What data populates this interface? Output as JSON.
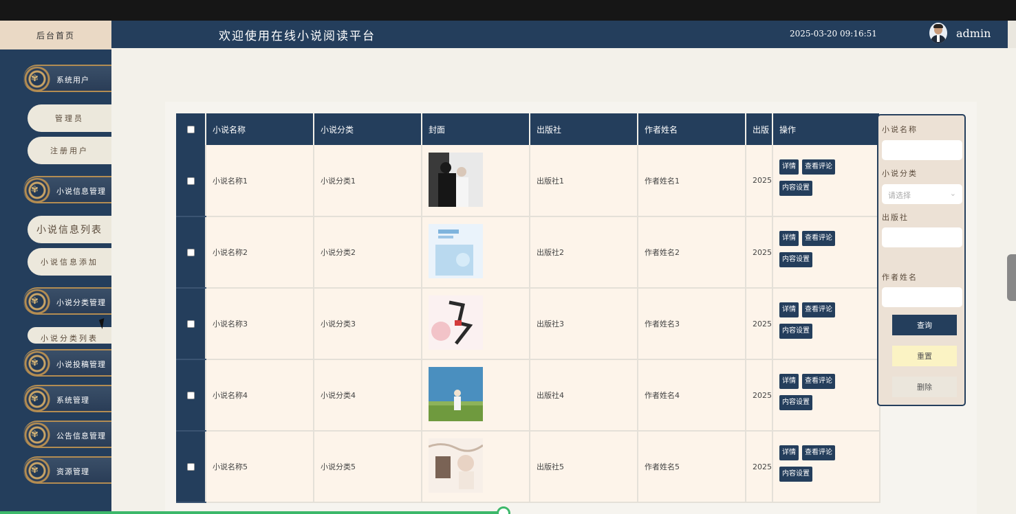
{
  "brand": "后台首页",
  "header": {
    "title": "欢迎使用在线小说阅读平台",
    "datetime": "2025-03-20 09:16:51",
    "user": "admin"
  },
  "sidebar": {
    "groups": {
      "system_users": "系统用户",
      "novel_info": "小说信息管理",
      "novel_category": "小说分类管理",
      "novel_submission": "小说投稿管理",
      "system": "系统管理",
      "announcement": "公告信息管理",
      "resource": "资源管理"
    },
    "items": {
      "admin": "管理员",
      "registered_users": "注册用户",
      "novel_list": "小说信息列表",
      "novel_add": "小说信息添加",
      "category_list": "小说分类列表"
    }
  },
  "table": {
    "columns": [
      "小说名称",
      "小说分类",
      "封面",
      "出版社",
      "作者姓名",
      "出版",
      "操作"
    ],
    "rows": [
      {
        "name": "小说名称1",
        "category": "小说分类1",
        "publisher": "出版社1",
        "author": "作者姓名1",
        "date": "2025"
      },
      {
        "name": "小说名称2",
        "category": "小说分类2",
        "publisher": "出版社2",
        "author": "作者姓名2",
        "date": "2025"
      },
      {
        "name": "小说名称3",
        "category": "小说分类3",
        "publisher": "出版社3",
        "author": "作者姓名3",
        "date": "2025"
      },
      {
        "name": "小说名称4",
        "category": "小说分类4",
        "publisher": "出版社4",
        "author": "作者姓名4",
        "date": "2025"
      },
      {
        "name": "小说名称5",
        "category": "小说分类5",
        "publisher": "出版社5",
        "author": "作者姓名5",
        "date": "2025"
      }
    ],
    "ops": {
      "detail": "详情",
      "comments": "查看评论",
      "content": "内容设置"
    }
  },
  "filter": {
    "name_label": "小说名称",
    "category_label": "小说分类",
    "category_placeholder": "请选择",
    "publisher_label": "出版社",
    "author_label": "作者姓名",
    "query": "查询",
    "reset": "重置",
    "delete": "删除"
  },
  "colors": {
    "primary": "#243e5c",
    "accent_gold": "#b48d52",
    "row_bg": "#fdf4ea"
  }
}
